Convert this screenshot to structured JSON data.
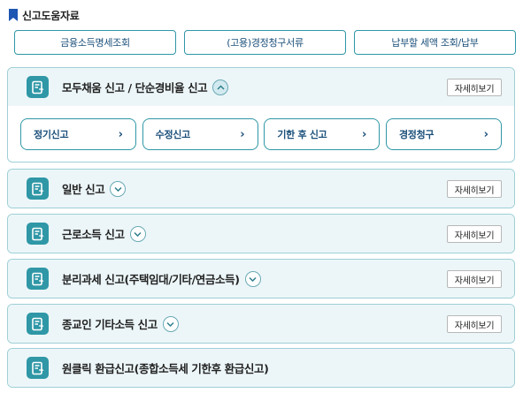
{
  "header": {
    "title": "신고도움자료",
    "icon": "bookmark-icon",
    "accent": "#1d56b3"
  },
  "help_links": [
    {
      "label": "금융소득명세조회"
    },
    {
      "label": "(고용)경정청구서류"
    },
    {
      "label": "납부할 세액 조회/납부"
    }
  ],
  "sections": [
    {
      "title": "모두채움 신고 / 단순경비율 신고",
      "expanded": true,
      "detail_label": "자세히보기",
      "sub_items": [
        {
          "label": "정기신고"
        },
        {
          "label": "수정신고"
        },
        {
          "label": "기한 후 신고"
        },
        {
          "label": "경정청구"
        }
      ]
    },
    {
      "title": "일반 신고",
      "expanded": false,
      "detail_label": "자세히보기"
    },
    {
      "title": "근로소득 신고",
      "expanded": false,
      "detail_label": "자세히보기"
    },
    {
      "title": "분리과세 신고(주택임대/기타/연금소득)",
      "expanded": false,
      "detail_label": "자세히보기"
    },
    {
      "title": "종교인 기타소득 신고",
      "expanded": false,
      "detail_label": "자세히보기"
    },
    {
      "title": "원클릭 환급신고(종합소득세 기한후 환급신고)"
    }
  ],
  "colors": {
    "teal": "#2f97a6",
    "section_bg": "#ecf6f8",
    "border": "#9ecfd6",
    "link_text": "#1a4f7a"
  }
}
